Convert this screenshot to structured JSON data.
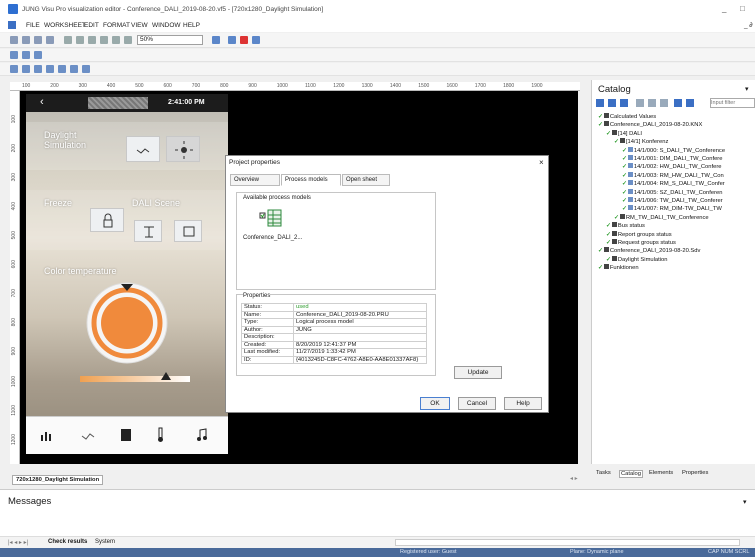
{
  "window": {
    "title": "JUNG Visu Pro visualization editor - Conference_DALI_2019-08-20.vf5 - [720x1280_Daylight Simulation]",
    "minimize": "_",
    "close": "□",
    "child_controls": "_ ∂"
  },
  "menu": [
    "FILE",
    "WORKSHEET",
    "EDIT",
    "FORMAT",
    "VIEW",
    "WINDOW",
    "HELP"
  ],
  "toolbar": {
    "zoom_value": "50%"
  },
  "ruler": {
    "top": [
      "100",
      "200",
      "300",
      "400",
      "500",
      "600",
      "700",
      "800",
      "900",
      "1000",
      "1100",
      "1200",
      "1300",
      "1400",
      "1500",
      "1600",
      "1700",
      "1800",
      "1900"
    ],
    "left": [
      "100",
      "200",
      "300",
      "400",
      "500",
      "600",
      "700",
      "800",
      "900",
      "1000",
      "1100",
      "1200"
    ]
  },
  "phone": {
    "back": "‹",
    "time": "2:41:00 PM",
    "daylight_label": "Daylight\nSimulation",
    "freeze_label": "Freeze",
    "dali_scene_label": "DALI Scene",
    "color_temp_label": "Color temperature",
    "accent": "#f08a3c",
    "slider_level": 0.78
  },
  "dialog": {
    "title": "Project properties",
    "close": "×",
    "tabs": [
      "Overview",
      "Process models",
      "Open sheet"
    ],
    "available_label": "Available process models",
    "model_name": "Conference_DALI_2...",
    "properties_label": "Properties",
    "properties": [
      {
        "key": "Status:",
        "value": "used"
      },
      {
        "key": "Name:",
        "value": "Conference_DALI_2019-08-20.PRU"
      },
      {
        "key": "Type:",
        "value": "Logical process model"
      },
      {
        "key": "Author:",
        "value": "JUNG"
      },
      {
        "key": "Description:",
        "value": ""
      },
      {
        "key": "Created:",
        "value": "8/20/2019 12:41:37 PM"
      },
      {
        "key": "Last modified:",
        "value": "11/27/2019 1:33:42 PM"
      },
      {
        "key": "ID:",
        "value": "{4013245D-C8FC-4762-A8E0-AA8E01337AF8}"
      }
    ],
    "update": "Update",
    "ok": "OK",
    "cancel": "Cancel",
    "help": "Help"
  },
  "catalog": {
    "title": "Catalog",
    "filter_placeholder": "Input filter",
    "tree": [
      {
        "level": 0,
        "text": "Calculated Values"
      },
      {
        "level": 0,
        "text": "Conference_DALI_2019-08-20.KNX"
      },
      {
        "level": 1,
        "text": "[14] DALI"
      },
      {
        "level": 2,
        "text": "[14/1] Konferenz"
      },
      {
        "level": 3,
        "text": "14/1/000: S_DALI_TW_Conference"
      },
      {
        "level": 3,
        "text": "14/1/001: DIM_DALI_TW_Confere"
      },
      {
        "level": 3,
        "text": "14/1/002: HW_DALI_TW_Confere"
      },
      {
        "level": 3,
        "text": "14/1/003: RM_HW_DALI_TW_Con"
      },
      {
        "level": 3,
        "text": "14/1/004: RM_S_DALI_TW_Confer"
      },
      {
        "level": 3,
        "text": "14/1/005: SZ_DALI_TW_Conferen"
      },
      {
        "level": 3,
        "text": "14/1/006: TW_DALI_TW_Conferer"
      },
      {
        "level": 3,
        "text": "14/1/007: RM_DIM-TW_DALI_TW"
      },
      {
        "level": 2,
        "text": "RM_TW_DALI_TW_Conference"
      },
      {
        "level": 1,
        "text": "Bus status"
      },
      {
        "level": 1,
        "text": "Report groups status"
      },
      {
        "level": 1,
        "text": "Request groups status"
      },
      {
        "level": 0,
        "text": "Conference_DALI_2019-08-20.Sdv"
      },
      {
        "level": 1,
        "text": "Daylight Simulation"
      },
      {
        "level": 0,
        "text": "Funktionen"
      }
    ],
    "bottom_tabs": [
      "Tasks",
      "Catalog",
      "Elements",
      "Properties"
    ]
  },
  "doc_tab": "720x1280_Daylight Simulation",
  "messages": {
    "title": "Messages",
    "tabs": [
      "Check results",
      "System"
    ]
  },
  "status": {
    "user": "Registered user: Guest",
    "plane": "Plane: Dynamic plane",
    "keys": "CAP  NUM  SCRL"
  }
}
